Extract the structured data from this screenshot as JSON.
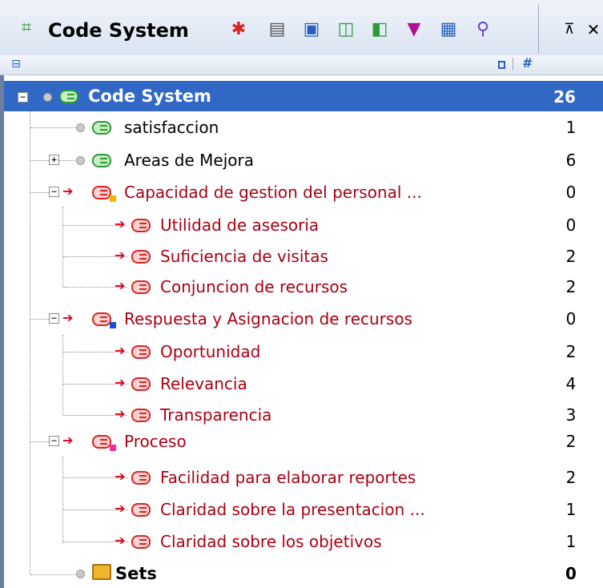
{
  "header": {
    "title": "Code System",
    "hash_symbol": "#",
    "toolbar_icons": [
      "code-system-icon",
      "color-grid-icon",
      "print-icon",
      "export-icon",
      "new-code-icon",
      "search-code-icon",
      "filter-icon",
      "expand-icon",
      "find-icon",
      "pin-icon",
      "close-icon"
    ]
  },
  "tree": {
    "root": {
      "label": "Code System",
      "count": "26"
    },
    "items": [
      {
        "label": "satisfaccion",
        "count": "1"
      },
      {
        "label": "Areas de Mejora",
        "count": "6"
      },
      {
        "label": "Capacidad de gestion del personal ...",
        "count": "0",
        "color": "#f7b500"
      },
      {
        "label": "Utilidad de asesoria",
        "count": "0"
      },
      {
        "label": "Suficiencia de visitas",
        "count": "2"
      },
      {
        "label": "Conjuncion de recursos",
        "count": "2"
      },
      {
        "label": "Respuesta y Asignacion de recursos",
        "count": "0",
        "color": "#1a4fd6"
      },
      {
        "label": "Oportunidad",
        "count": "2"
      },
      {
        "label": "Relevancia",
        "count": "4"
      },
      {
        "label": "Transparencia",
        "count": "3"
      },
      {
        "label": "Proceso",
        "count": "2",
        "color": "#ff2aa0"
      },
      {
        "label": "Facilidad para elaborar reportes",
        "count": "2"
      },
      {
        "label": "Claridad sobre la presentacion ...",
        "count": "1"
      },
      {
        "label": "Claridad sobre los objetivos",
        "count": "1"
      }
    ],
    "sets": {
      "label": "Sets",
      "count": "0"
    }
  },
  "colors": {
    "selection": "#3168c5",
    "red_text": "#c0001b",
    "accent": "#e0001b"
  }
}
